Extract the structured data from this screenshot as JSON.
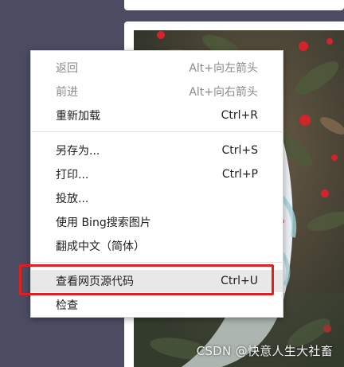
{
  "context_menu": {
    "groups": [
      [
        {
          "label": "返回",
          "shortcut": "Alt+向左箭头",
          "disabled": true
        },
        {
          "label": "前进",
          "shortcut": "Alt+向右箭头",
          "disabled": true
        },
        {
          "label": "重新加载",
          "shortcut": "Ctrl+R",
          "disabled": false
        }
      ],
      [
        {
          "label": "另存为...",
          "shortcut": "Ctrl+S",
          "disabled": false
        },
        {
          "label": "打印...",
          "shortcut": "Ctrl+P",
          "disabled": false
        },
        {
          "label": "投放...",
          "shortcut": "",
          "disabled": false
        },
        {
          "label": "使用 Bing搜索图片",
          "shortcut": "",
          "disabled": false
        },
        {
          "label": "翻成中文（简体）",
          "shortcut": "",
          "disabled": false
        }
      ],
      [
        {
          "label": "查看网页源代码",
          "shortcut": "Ctrl+U",
          "disabled": false,
          "highlighted": true
        },
        {
          "label": "检查",
          "shortcut": "",
          "disabled": false
        }
      ]
    ]
  },
  "artwork": {
    "watermark": "CSDN @快意人生大社畜"
  },
  "colors": {
    "page_background": "#4b4c62",
    "highlight_border": "#e02020",
    "hover_background": "#e8e8e8"
  }
}
